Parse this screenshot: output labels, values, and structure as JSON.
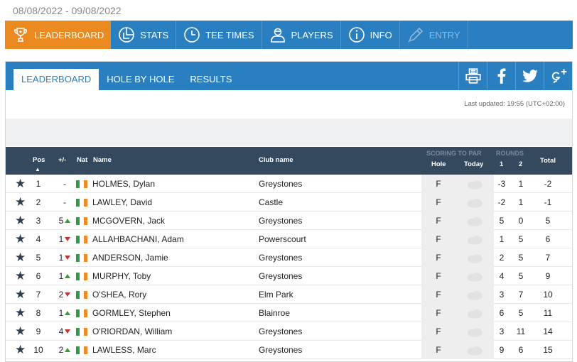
{
  "date_range": "08/08/2022 - 09/08/2022",
  "main_nav": [
    {
      "label": "LEADERBOARD",
      "icon": "trophy-icon",
      "state": "active"
    },
    {
      "label": "STATS",
      "icon": "pie-chart-icon",
      "state": "normal"
    },
    {
      "label": "TEE TIMES",
      "icon": "clock-icon",
      "state": "normal"
    },
    {
      "label": "PLAYERS",
      "icon": "user-icon",
      "state": "normal"
    },
    {
      "label": "INFO",
      "icon": "info-icon",
      "state": "normal"
    },
    {
      "label": "ENTRY",
      "icon": "pen-icon",
      "state": "disabled"
    }
  ],
  "sub_tabs": [
    {
      "label": "LEADERBOARD",
      "active": true
    },
    {
      "label": "HOLE BY HOLE",
      "active": false
    },
    {
      "label": "RESULTS",
      "active": false
    }
  ],
  "social": [
    "print-icon",
    "facebook-icon",
    "twitter-icon",
    "google-plus-icon"
  ],
  "last_updated": "Last updated: 19:55 (UTC+02:00)",
  "table_header": {
    "pos": "Pos",
    "movement": "+/-",
    "nat": "Nat",
    "name": "Name",
    "club": "Club name",
    "scoring_group": "SCORING TO PAR",
    "rounds_group": "ROUNDS",
    "hole": "Hole",
    "today": "Today",
    "r1": "1",
    "r2": "2",
    "total": "Total"
  },
  "colors": {
    "nav_blue": "#2a7fc1",
    "active_orange": "#ea8a20",
    "header_dark": "#34495e",
    "flag_green": "#2e9a48",
    "flag_white": "#ffffff",
    "flag_orange": "#f08a24",
    "up": "#3a9a3a",
    "down": "#c83232"
  },
  "rows": [
    {
      "pos": "1",
      "move": "-",
      "dir": "",
      "name": "HOLMES, Dylan",
      "club": "Greystones",
      "hole": "F",
      "r1": "-3",
      "r2": "1",
      "total": "-2"
    },
    {
      "pos": "2",
      "move": "-",
      "dir": "",
      "name": "LAWLEY, David",
      "club": "Castle",
      "hole": "F",
      "r1": "-2",
      "r2": "1",
      "total": "-1"
    },
    {
      "pos": "3",
      "move": "5",
      "dir": "up",
      "name": "MCGOVERN, Jack",
      "club": "Greystones",
      "hole": "F",
      "r1": "5",
      "r2": "0",
      "total": "5"
    },
    {
      "pos": "4",
      "move": "1",
      "dir": "down",
      "name": "ALLAHBACHANI, Adam",
      "club": "Powerscourt",
      "hole": "F",
      "r1": "1",
      "r2": "5",
      "total": "6"
    },
    {
      "pos": "5",
      "move": "1",
      "dir": "down",
      "name": "ANDERSON, Jamie",
      "club": "Greystones",
      "hole": "F",
      "r1": "2",
      "r2": "5",
      "total": "7"
    },
    {
      "pos": "6",
      "move": "1",
      "dir": "up",
      "name": "MURPHY, Toby",
      "club": "Greystones",
      "hole": "F",
      "r1": "4",
      "r2": "5",
      "total": "9"
    },
    {
      "pos": "7",
      "move": "2",
      "dir": "down",
      "name": "O'SHEA, Rory",
      "club": "Elm Park",
      "hole": "F",
      "r1": "3",
      "r2": "7",
      "total": "10"
    },
    {
      "pos": "8",
      "move": "1",
      "dir": "up",
      "name": "GORMLEY, Stephen",
      "club": "Blainroe",
      "hole": "F",
      "r1": "6",
      "r2": "5",
      "total": "11"
    },
    {
      "pos": "9",
      "move": "4",
      "dir": "down",
      "name": "O'RIORDAN, William",
      "club": "Greystones",
      "hole": "F",
      "r1": "3",
      "r2": "11",
      "total": "14"
    },
    {
      "pos": "10",
      "move": "2",
      "dir": "up",
      "name": "LAWLESS, Marc",
      "club": "Greystones",
      "hole": "F",
      "r1": "9",
      "r2": "6",
      "total": "15"
    }
  ]
}
